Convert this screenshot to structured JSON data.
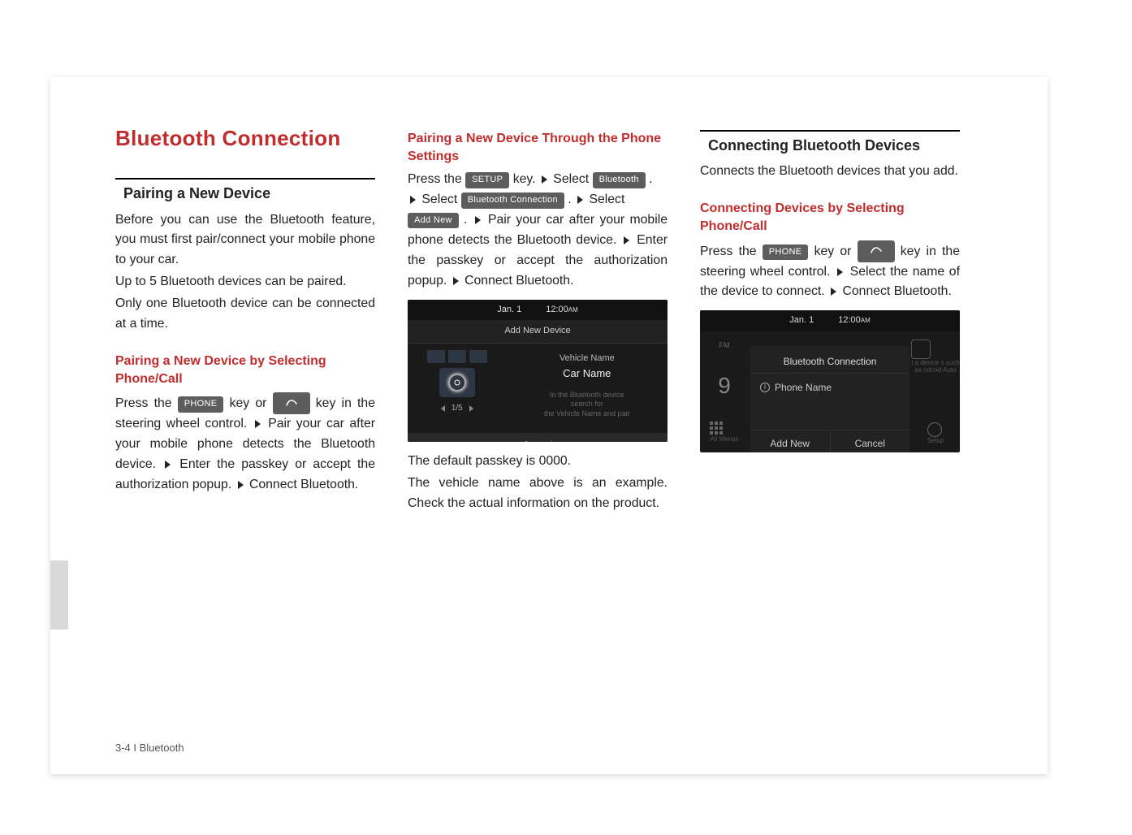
{
  "footer": "3-4 I Bluetooth",
  "mainTitle": "Bluetooth Connection",
  "col1": {
    "section1_h": "Pairing a New Device",
    "p1": "Before you can use the Bluetooth feature, you must first pair/connect your mobile phone to your car.",
    "p2": "Up to 5 Bluetooth devices can be paired.",
    "p3": "Only one Bluetooth device can be connected at a time.",
    "sub_red": "Pairing a New Device by Selecting Phone/Call",
    "p4a": "Press the ",
    "key_phone": "PHONE",
    "p4b": " key or ",
    "p4c": " key in the steering wheel control.",
    "step2": " Pair your car after your mobile phone detects the Bluetooth device.",
    "step3": " Enter the passkey or accept the authorization popup.",
    "step4": " Connect Bluetooth."
  },
  "col2": {
    "sub_red": "Pairing a New Device Through the Phone Settings",
    "p1a": "Press the ",
    "key_setup": "SETUP",
    "p1b": " key.",
    "p1c": " Select ",
    "key_bt": "Bluetooth",
    "p1d": ".",
    "p2a": " Select ",
    "key_btconn": "Bluetooth Connection",
    "p2b": " .  ",
    "p2c": " Select",
    "p3a": "",
    "key_addnew": "Add New",
    "p3b": ".",
    "p3c": " Pair your car after your mobile phone detects the Bluetooth device.",
    "p4": " Enter the passkey or accept the authorization popup.",
    "p5": " Connect Bluetooth.",
    "ss": {
      "date": "Jan. 1",
      "time": "12:00",
      "ampm": "AM",
      "title": "Add New Device",
      "vehicle_label": "Vehicle Name",
      "vehicle_value": "Car Name",
      "hint1": "In the Bluetooth device",
      "hint2": "search for",
      "hint3": "the Vehicle Name and pair",
      "pager": "1/5",
      "cancel": "Cancel"
    },
    "after1": "The default passkey is 0000.",
    "after2": "The vehicle name above is an example. Check the actual information on the product."
  },
  "col3": {
    "section_h": "Connecting Bluetooth Devices",
    "p1": "Connects the Bluetooth devices that you add.",
    "sub_red": "Connecting Devices by Selecting Phone/Call",
    "p2a": "Press the ",
    "key_phone": "PHONE",
    "p2b": " key or ",
    "p2c": " key in the steering wheel control.",
    "p3": " Select the name of the device to connect.",
    "p4": " Connect Bluetooth.",
    "ss": {
      "date": "Jan. 1",
      "time": "12:00",
      "ampm": "AM",
      "fm": "FM",
      "nine": "9",
      "allmenus": "All Menus",
      "popup_title": "Bluetooth Connection",
      "phone_row": "Phone Name",
      "addnew": "Add New",
      "cancel": "Cancel",
      "right_hint": "t a device\ns such as\nndroid Auto",
      "setup_lbl": "Setup"
    }
  }
}
